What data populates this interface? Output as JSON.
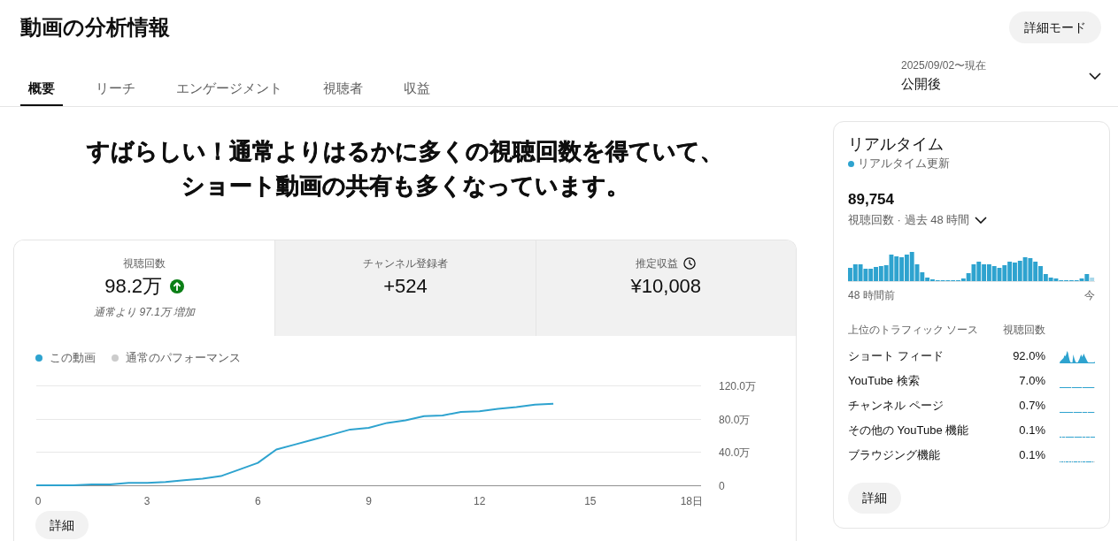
{
  "page": {
    "title": "動画の分析情報",
    "mode_button": "詳細モード"
  },
  "tabs": [
    {
      "label": "概要",
      "selected": true
    },
    {
      "label": "リーチ",
      "selected": false
    },
    {
      "label": "エンゲージメント",
      "selected": false
    },
    {
      "label": "視聴者",
      "selected": false
    },
    {
      "label": "収益",
      "selected": false
    }
  ],
  "date_range": {
    "range": "2025/09/02〜現在",
    "label": "公開後"
  },
  "headline": "すばらしい！通常よりはるかに多くの視聴回数を得ていて、ショート動画の共有も多くなっています。",
  "metrics": [
    {
      "kind": "views",
      "label": "視聴回数",
      "value": "98.2万",
      "rising": true,
      "note": "通常より 97.1万 増加",
      "selected": true
    },
    {
      "kind": "count",
      "label": "チャンネル登録者",
      "value": "+524",
      "selected": false
    },
    {
      "kind": "estimate",
      "label": "推定収益",
      "value": "¥10,008",
      "selected": false
    }
  ],
  "chart": {
    "chart_data": {
      "type": "line",
      "x": [
        0,
        0.5,
        1,
        1.5,
        2,
        2.5,
        3,
        3.5,
        4,
        4.5,
        5,
        5.5,
        6,
        6.5,
        7,
        7.5,
        8,
        8.5,
        9,
        9.5,
        10,
        10.5,
        11,
        11.5,
        12,
        12.5,
        13,
        13.5,
        14
      ],
      "series": [
        {
          "name": "この動画",
          "color": "#2ea3cf",
          "values": [
            0,
            0,
            0,
            1,
            1,
            3,
            3,
            4,
            6,
            8,
            11,
            19,
            27,
            43,
            49,
            55,
            61,
            67,
            69,
            75,
            78,
            83,
            84,
            88,
            89,
            92,
            94,
            97,
            98
          ]
        },
        {
          "name": "通常のパフォーマンス",
          "color": "#cccccc",
          "values": [
            null,
            null,
            null,
            null,
            null,
            null,
            null,
            null,
            null,
            null,
            null,
            null,
            null,
            null,
            null,
            null,
            null,
            null,
            null,
            null,
            null,
            null,
            null,
            null,
            null,
            null,
            null,
            null,
            null
          ]
        }
      ],
      "xlim": [
        0,
        18
      ],
      "ylim": [
        0,
        120
      ],
      "xticks": [
        0,
        3,
        6,
        9,
        12,
        15,
        {
          "value": 18,
          "label": "18日"
        }
      ],
      "yticks": [
        0,
        {
          "value": 40,
          "label": "40.0万"
        },
        {
          "value": 80,
          "label": "80.0万"
        },
        {
          "value": 120,
          "label": "120.0万"
        }
      ]
    },
    "button": "詳細"
  },
  "realtime": {
    "title": "リアルタイム",
    "status": "リアルタイム更新",
    "views": "89,754",
    "period": "視聴回数 · 過去 48 時間",
    "axis_start": "48 時間前",
    "axis_end": "今",
    "traffic_header": "上位のトラフィック ソース",
    "traffic_column": "視聴回数",
    "traffic": [
      {
        "source": "ショート フィード",
        "share": "92.0%"
      },
      {
        "source": "YouTube 検索",
        "share": "7.0%"
      },
      {
        "source": "チャンネル ページ",
        "share": "0.7%"
      },
      {
        "source": "その他の YouTube 機能",
        "share": "0.1%"
      },
      {
        "source": "ブラウジング機能",
        "share": "0.1%"
      }
    ],
    "button": "詳細"
  }
}
